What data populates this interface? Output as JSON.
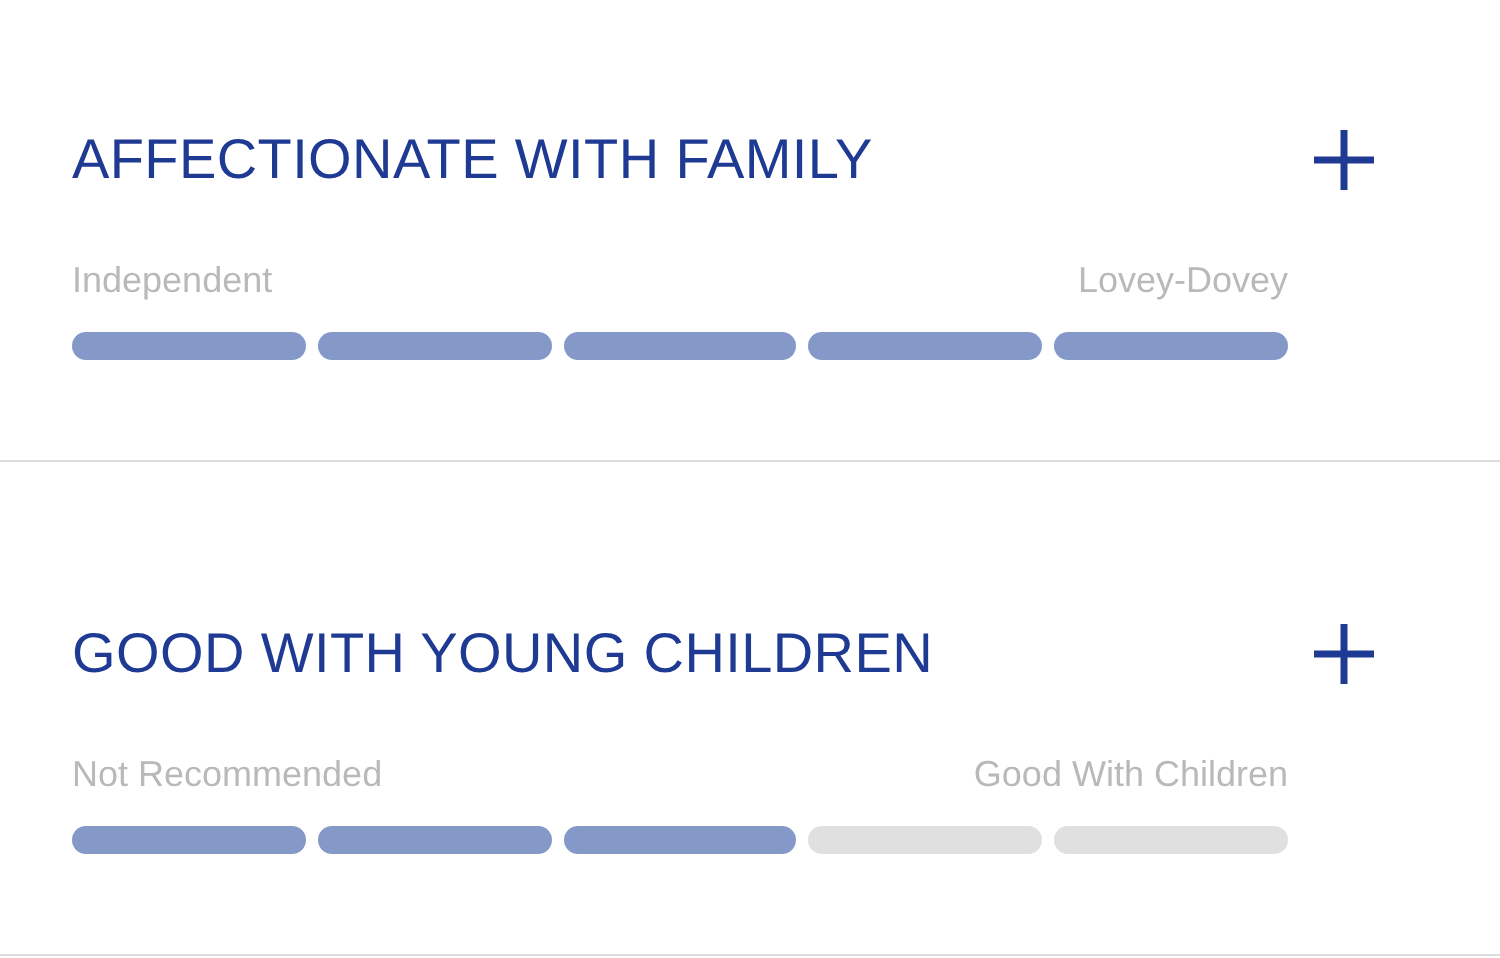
{
  "traits": [
    {
      "title": "AFFECTIONATE WITH FAMILY",
      "low_label": "Independent",
      "high_label": "Lovey-Dovey",
      "stars": 5
    },
    {
      "title": "GOOD WITH YOUNG CHILDREN",
      "low_label": "Not Recommended",
      "high_label": "Good With Children",
      "stars": 3
    }
  ]
}
